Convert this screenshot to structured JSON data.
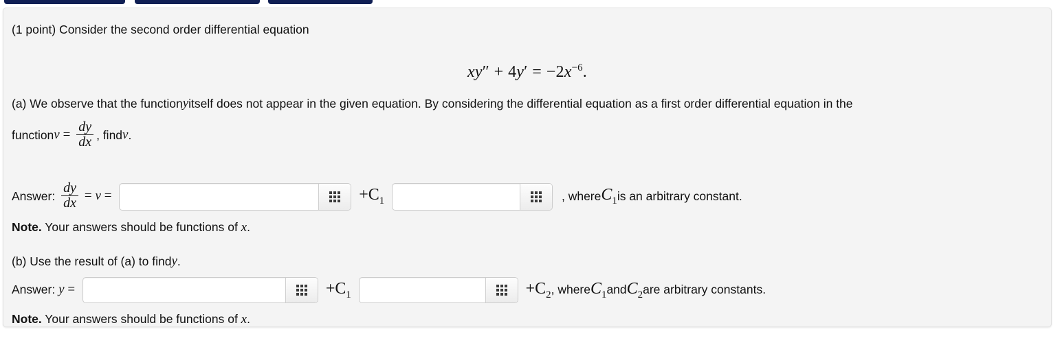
{
  "topnav": {
    "buttons": [
      {
        "name": "nav-button-1",
        "label": ""
      },
      {
        "name": "nav-button-2",
        "label": ""
      },
      {
        "name": "nav-button-3",
        "label": ""
      }
    ],
    "color": "#101f54"
  },
  "panel": {
    "background": "#f4f4f4",
    "border_color": "#e2e2e2"
  },
  "problem": {
    "points_text": "(1 point) Consider the second order differential equation",
    "equation": "xy″ + 4y′ = −2x⁻⁶.",
    "equation_parts": {
      "lhs_x": "x",
      "lhs_y": "y",
      "lhs_y_primes": "″",
      "plus": "+",
      "coef": "4",
      "y2": "y",
      "y2_prime": "′",
      "equals": "=",
      "rhs_sign": "−",
      "rhs_coef": "2",
      "rhs_var": "x",
      "rhs_exp": "−6",
      "period": "."
    },
    "part_a": {
      "text_before_v": "(a) We observe that the function ",
      "var_y": "y",
      "text_after_y": " itself does not appear in the given equation. By considering the differential equation as a first order differential equation in the",
      "line2_prefix": "function ",
      "var_v": "v",
      "equals": "=",
      "frac_num": "dy",
      "frac_den": "dx",
      "line2_suffix": ", find ",
      "var_v2": "v",
      "period": "."
    },
    "answer_a": {
      "label": "Answer:",
      "frac_num": "dy",
      "frac_den": "dx",
      "equals1": "=",
      "var_v": "v",
      "equals2": "=",
      "field1_value": "",
      "field1_placeholder": "",
      "plus_c1": "+C",
      "c1_sub": "1",
      "field2_value": "",
      "field2_placeholder": "",
      "trailing_text_1": ", where ",
      "trailing_c": "C",
      "trailing_c_sub": "1",
      "trailing_text_2": " is an arbitrary constant.",
      "keypad_icon": "keypad-grid-icon"
    },
    "note_a": {
      "bold": "Note.",
      "text": " Your answers should be functions of ",
      "var": "x",
      "period": "."
    },
    "part_b": {
      "text": "(b) Use the result of (a) to find ",
      "var_y": "y",
      "period": "."
    },
    "answer_b": {
      "label": "Answer:",
      "var_y": "y",
      "equals": "=",
      "field1_value": "",
      "field1_placeholder": "",
      "plus_c1": "+C",
      "c1_sub": "1",
      "field2_value": "",
      "field2_placeholder": "",
      "plus_c2": "+C",
      "c2_sub": "2",
      "trailing_text_1": ", where ",
      "trailing_c1": "C",
      "trailing_c1_sub": "1",
      "trailing_and": " and ",
      "trailing_c2": "C",
      "trailing_c2_sub": "2",
      "trailing_text_2": " are arbitrary constants.",
      "keypad_icon": "keypad-grid-icon"
    },
    "note_b": {
      "bold": "Note.",
      "text": " Your answers should be functions of ",
      "var": "x",
      "period": "."
    }
  }
}
